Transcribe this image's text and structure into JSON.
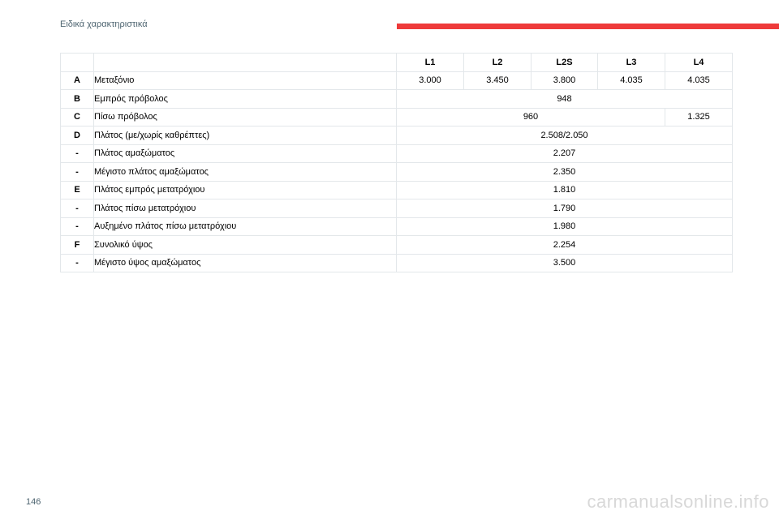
{
  "header": {
    "section_title": "Ειδικά χαρακτηριστικά",
    "accent_color": "#ee3a3a"
  },
  "table": {
    "columns": [
      "L1",
      "L2",
      "L2S",
      "L3",
      "L4"
    ],
    "rows": [
      {
        "code": "A",
        "label": "Μεταξόνιο",
        "values": [
          "3.000",
          "3.450",
          "3.800",
          "4.035",
          "4.035"
        ]
      },
      {
        "code": "B",
        "label": "Εμπρός πρόβολος",
        "all": "948"
      },
      {
        "code": "C",
        "label": "Πίσω πρόβολος",
        "first4": "960",
        "last": "1.325"
      },
      {
        "code": "D",
        "label": "Πλάτος (με/χωρίς καθρέπτες)",
        "all": "2.508/2.050"
      },
      {
        "code": "-",
        "label": "Πλάτος αμαξώματος",
        "all": "2.207"
      },
      {
        "code": "-",
        "label": "Μέγιστο πλάτος αμαξώματος",
        "all": "2.350"
      },
      {
        "code": "E",
        "label": "Πλάτος εμπρός μετατρόχιου",
        "all": "1.810"
      },
      {
        "code": "-",
        "label": "Πλάτος πίσω μετατρόχιου",
        "all": "1.790"
      },
      {
        "code": "-",
        "label": "Αυξημένο πλάτος πίσω μετατρόχιου",
        "all": "1.980"
      },
      {
        "code": "F",
        "label": "Συνολικό ύψος",
        "all": "2.254"
      },
      {
        "code": "-",
        "label": "Μέγιστο ύψος αμαξώματος",
        "all": "3.500"
      }
    ]
  },
  "footer": {
    "page_number": "146",
    "watermark": "carmanualsonline.info"
  }
}
